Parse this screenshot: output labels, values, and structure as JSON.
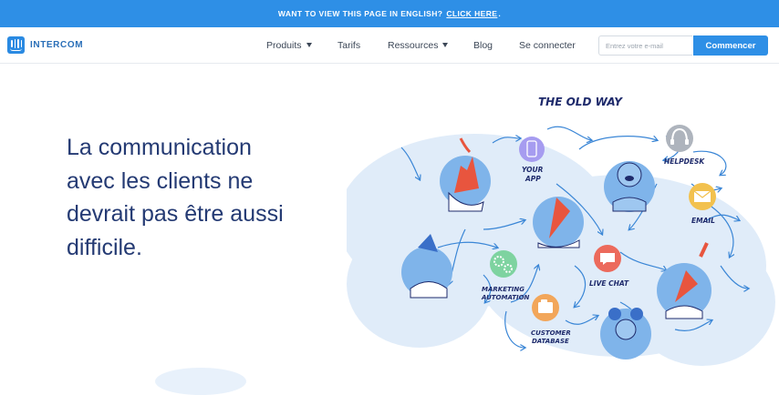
{
  "banner": {
    "text": "WANT TO VIEW THIS PAGE IN ENGLISH?",
    "link": "CLICK HERE",
    "end": "."
  },
  "nav": {
    "logo": "INTERCOM",
    "items": {
      "produits": "Produits",
      "tarifs": "Tarifs",
      "ressources": "Ressources",
      "blog": "Blog",
      "login": "Se connecter"
    },
    "email_placeholder": "Entrez votre e-mail",
    "cta": "Commencer"
  },
  "hero": {
    "line1": "La communication",
    "line2": "avec les clients ne",
    "line3": "devrait pas être aussi",
    "line4": "difficile."
  },
  "illustration": {
    "title": "THE OLD WAY",
    "labels": {
      "app1": "YOUR",
      "app2": "APP",
      "helpdesk": "HELPDESK",
      "email": "EMAIL",
      "marketing1": "MARKETING",
      "marketing2": "AUTOMATION",
      "livechat": "LIVE CHAT",
      "database1": "CUSTOMER",
      "database2": "DATABASE"
    },
    "icons": [
      "phone-app-icon",
      "headset-icon",
      "envelope-icon",
      "gears-icon",
      "chat-bubble-icon",
      "folders-icon"
    ]
  },
  "colors": {
    "brand_blue": "#2e8fe6",
    "headline": "#243a73",
    "wash": "#dbe9f8",
    "arrow": "#3a86d6"
  }
}
